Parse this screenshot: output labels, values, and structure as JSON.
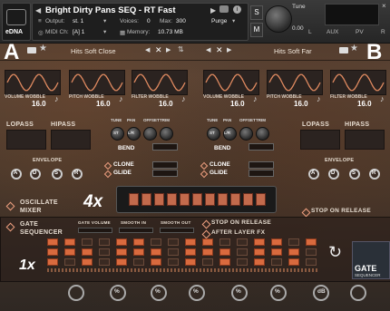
{
  "header": {
    "instrument_name": "Bright Dirty Pans SEQ - RT Fast",
    "output_label": "Output:",
    "output_value": "st. 1",
    "voices_label": "Voices:",
    "voices_value": "0",
    "max_label": "Max:",
    "max_value": "300",
    "purge_label": "Purge",
    "midi_label": "MIDI Ch:",
    "midi_value": "[A]  1",
    "memory_label": "Memory:",
    "memory_value": "10.73 MB",
    "tune_label": "Tune",
    "tune_value": "0.00",
    "logo_text": "eDNA",
    "s_button": "S",
    "m_button": "M",
    "l_label": "L",
    "r_label": "R",
    "aux_label": "AUX",
    "pv_label": "PV"
  },
  "layers": {
    "a_letter": "A",
    "b_letter": "B",
    "a_preset": "Hits Soft Close",
    "b_preset": "Hits Soft Far"
  },
  "wave_modules": [
    {
      "label": "VOLUME WOBBLE",
      "value": "16.0"
    },
    {
      "label": "PITCH WOBBLE",
      "value": "16.0"
    },
    {
      "label": "FILTER WOBBLE",
      "value": "16.0"
    },
    {
      "label": "VOLUME WOBBLE",
      "value": "16.0"
    },
    {
      "label": "PITCH WOBBLE",
      "value": "16.0"
    },
    {
      "label": "FILTER WOBBLE",
      "value": "16.0"
    }
  ],
  "filters": {
    "lopass": "LOPASS",
    "hipass": "HIPASS",
    "envelope": "ENVELOPE",
    "adsr": [
      "A",
      "D",
      "S",
      "R"
    ]
  },
  "center": {
    "tune": "TUNE",
    "pan": "PAN",
    "offset": "OFFSET",
    "trim": "TRIM",
    "st": "ST",
    "lr": "L/R",
    "bend": "BEND",
    "clone": "CLONE",
    "glide": "GLIDE"
  },
  "oscillate": {
    "label": "OSCILLATE MIXER",
    "multiplier": "4x",
    "stop_release": "STOP ON RELEASE"
  },
  "sequencer": {
    "label": "GATE SEQUENCER",
    "gate_volume": "GATE VOLUME",
    "smooth_in": "SMOOTH IN",
    "smooth_out": "SMOOTH OUT",
    "stop_on_release": "STOP ON RELEASE",
    "after_layer_fx": "AFTER LAYER FX",
    "multiplier": "1x",
    "badge_title": "GATE",
    "badge_sub": "SEQUENCER"
  },
  "bottom_knob_icons": [
    "%",
    "%",
    "%",
    "%",
    "%",
    "dB"
  ],
  "colors": {
    "accent": "#d96a3e",
    "panel_dark": "#2b2320",
    "text": "#e6dcd0"
  }
}
